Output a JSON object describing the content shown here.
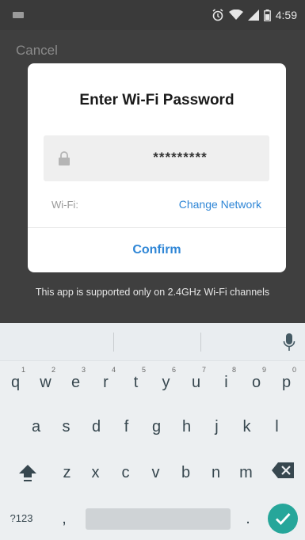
{
  "status_bar": {
    "time": "4:59"
  },
  "app_bar": {
    "cancel_label": "Cancel"
  },
  "dialog": {
    "title": "Enter Wi-Fi Password",
    "password_value": "*********",
    "wifi_label": "Wi-Fi:",
    "change_network_label": "Change Network",
    "confirm_label": "Confirm"
  },
  "support_note": "This app is supported only on 2.4GHz Wi-Fi channels",
  "keyboard": {
    "row1": [
      {
        "label": "q",
        "hint": "1"
      },
      {
        "label": "w",
        "hint": "2"
      },
      {
        "label": "e",
        "hint": "3"
      },
      {
        "label": "r",
        "hint": "4"
      },
      {
        "label": "t",
        "hint": "5"
      },
      {
        "label": "y",
        "hint": "6"
      },
      {
        "label": "u",
        "hint": "7"
      },
      {
        "label": "i",
        "hint": "8"
      },
      {
        "label": "o",
        "hint": "9"
      },
      {
        "label": "p",
        "hint": "0"
      }
    ],
    "row2": [
      "a",
      "s",
      "d",
      "f",
      "g",
      "h",
      "j",
      "k",
      "l"
    ],
    "row3": [
      "z",
      "x",
      "c",
      "v",
      "b",
      "n",
      "m"
    ],
    "symbols_label": "?123",
    "comma_label": ",",
    "period_label": "."
  },
  "colors": {
    "accent": "#2f86d6",
    "enter_key": "#26a69a"
  },
  "icons": [
    "lock-icon",
    "mic-icon",
    "shift-icon",
    "backspace-icon",
    "check-icon",
    "alarm-icon",
    "wifi-icon",
    "signal-icon",
    "battery-icon"
  ]
}
